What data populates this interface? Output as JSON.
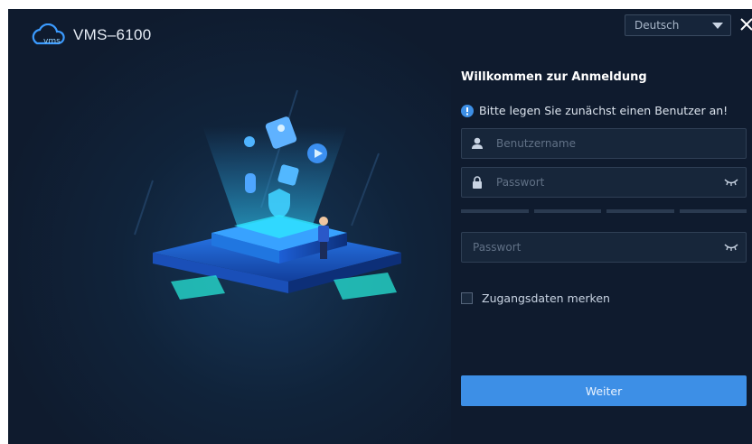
{
  "app": {
    "title": "VMS–6100",
    "logo_text": "vms"
  },
  "language": {
    "selected": "Deutsch"
  },
  "login": {
    "heading": "Willkommen zur Anmeldung",
    "hint": "Bitte legen Sie zunächst einen Benutzer an!",
    "username_placeholder": "Benutzername",
    "password_placeholder": "Passwort",
    "confirm_password_placeholder": "Passwort",
    "remember_label": "Zugangsdaten merken",
    "remember_checked": false,
    "submit_label": "Weiter"
  },
  "icons": {
    "logo": "cloud-logo-icon",
    "dropdown": "chevron-down-icon",
    "close": "close-icon",
    "info": "info-circle-icon",
    "user": "user-icon",
    "lock": "lock-icon",
    "eye": "eye-closed-icon"
  },
  "colors": {
    "background": "#0f1b2e",
    "accent": "#3d8fe6",
    "field_bg": "#17263a",
    "field_border": "#2f3f55"
  }
}
